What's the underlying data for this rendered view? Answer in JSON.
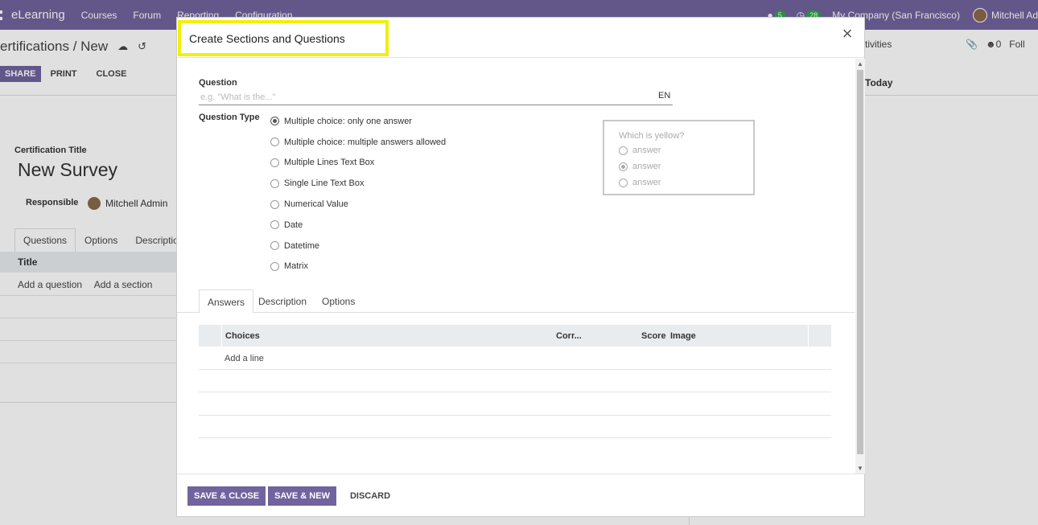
{
  "topbar": {
    "app_name": "eLearning",
    "menus": [
      "Courses",
      "Forum",
      "Reporting",
      "Configuration"
    ],
    "chat_count": "5",
    "activity_count": "28",
    "company": "My Company (San Francisco)",
    "user": "Mitchell Ad"
  },
  "control": {
    "breadcrumb": "ertifications / New",
    "share": "SHARE",
    "print": "PRINT",
    "close": "CLOSE",
    "activities": "tivities",
    "attachments": "0",
    "follow": "Foll"
  },
  "chatter": {
    "today": "Today"
  },
  "form": {
    "cert_label": "Certification Title",
    "cert_title": "New Survey",
    "responsible_label": "Responsible",
    "responsible_value": "Mitchell Admin",
    "tabs": [
      "Questions",
      "Options",
      "Description"
    ],
    "table_title": "Title",
    "add_question": "Add a question",
    "add_section": "Add a section"
  },
  "modal": {
    "title": "Create Sections and Questions",
    "question_label": "Question",
    "question_placeholder": "e.g. \"What is the...\"",
    "lang": "EN",
    "question_type_label": "Question Type",
    "question_types": [
      "Multiple choice: only one answer",
      "Multiple choice: multiple answers allowed",
      "Multiple Lines Text Box",
      "Single Line Text Box",
      "Numerical Value",
      "Date",
      "Datetime",
      "Matrix"
    ],
    "selected_type_index": 0,
    "preview": {
      "question": "Which is yellow?",
      "answers": [
        "answer",
        "answer",
        "answer"
      ]
    },
    "tabs": [
      "Answers",
      "Description",
      "Options"
    ],
    "table": {
      "headers": [
        "Choices",
        "Corr...",
        "Score",
        "Image"
      ],
      "add_line": "Add a line"
    },
    "footer": {
      "save_close": "SAVE & CLOSE",
      "save_new": "SAVE & NEW",
      "discard": "DISCARD"
    }
  }
}
